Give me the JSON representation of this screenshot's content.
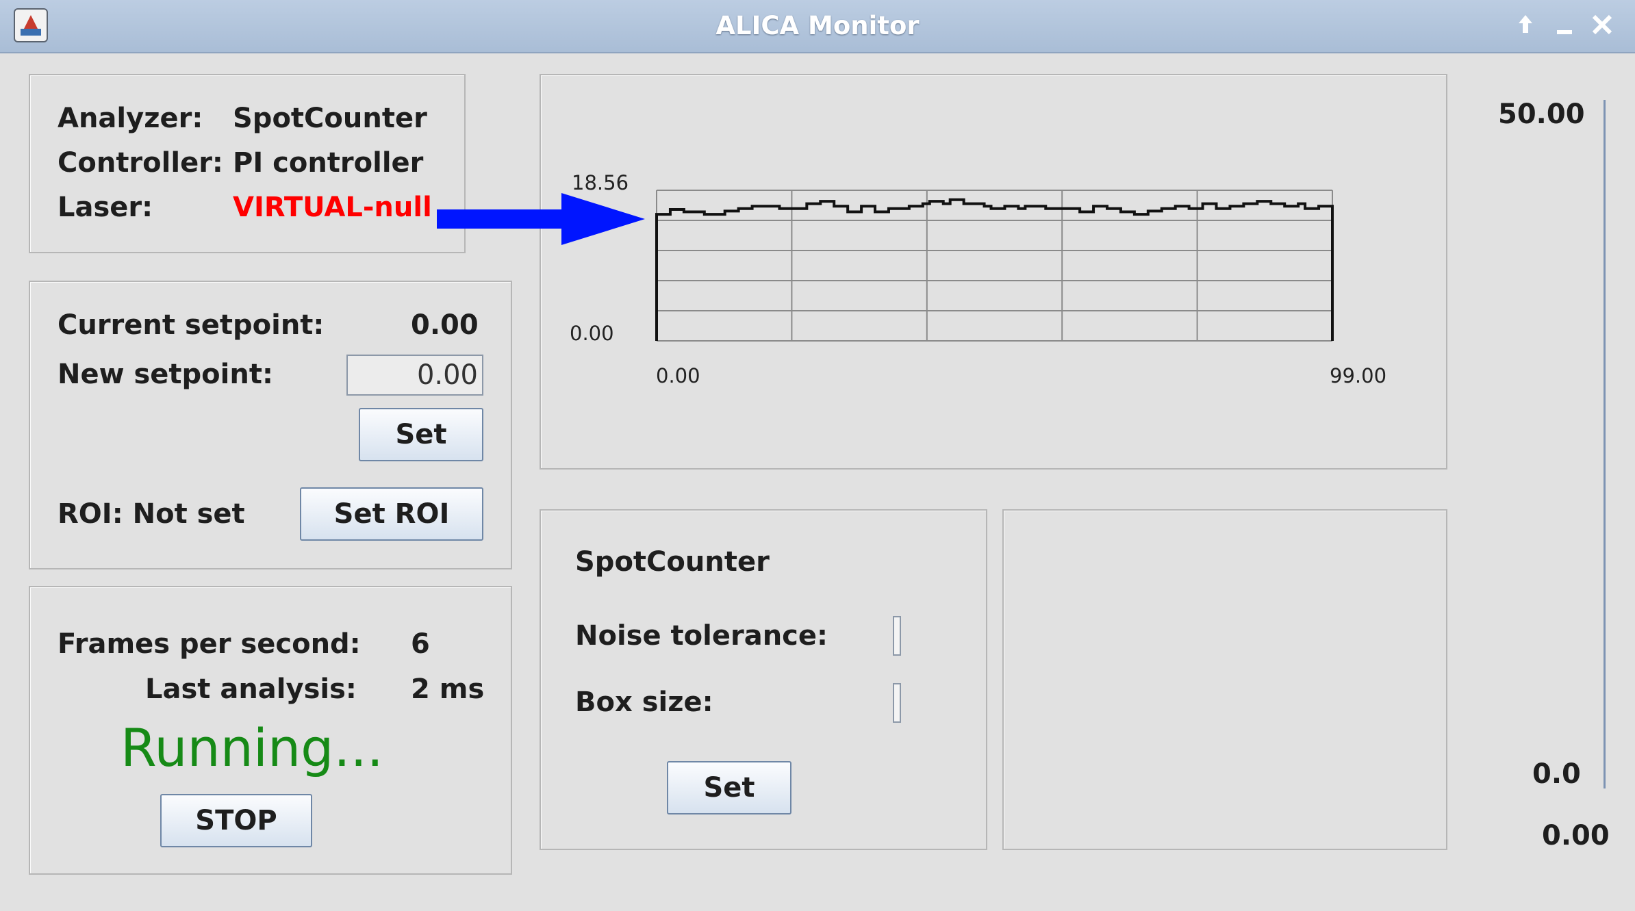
{
  "window": {
    "title": "ALICA Monitor"
  },
  "info": {
    "analyzer_label": "Analyzer:",
    "analyzer_value": "SpotCounter",
    "controller_label": "Controller:",
    "controller_value": "PI controller",
    "laser_label": "Laser:",
    "laser_value": "VIRTUAL-null"
  },
  "setpoint": {
    "current_label": "Current setpoint:",
    "current_value": "0.00",
    "new_label": "New setpoint:",
    "new_value": "0.00",
    "set_button": "Set",
    "roi_label": "ROI: Not set",
    "roi_button": "Set ROI"
  },
  "status": {
    "fps_label": "Frames per second:",
    "fps_value": "6",
    "last_label": "Last analysis:",
    "last_value": "2 ms",
    "running_text": "Running...",
    "stop_button": "STOP"
  },
  "analyzer_panel": {
    "title": "SpotCounter",
    "noise_label": "Noise tolerance:",
    "box_label": "Box size:",
    "set_button": "Set"
  },
  "right_scale": {
    "top": "50.00",
    "bottom": "0.0",
    "value": "0.00"
  },
  "colors": {
    "laser": "#ff0000",
    "running": "#168a16",
    "arrow": "#0015ff"
  },
  "chart_data": {
    "type": "line",
    "y_max_label": "18.56",
    "y_min_label": "0.00",
    "x_min_label": "0.00",
    "x_max_label": "99.00",
    "xlim": [
      0,
      99
    ],
    "ylim": [
      0,
      18.56
    ],
    "grid": true,
    "series": [
      {
        "values": [
          15.6,
          15.6,
          16.2,
          16.2,
          15.9,
          15.9,
          15.9,
          15.6,
          15.6,
          15.6,
          16.0,
          16.0,
          16.3,
          16.3,
          16.6,
          16.6,
          16.6,
          16.6,
          16.3,
          16.3,
          16.3,
          16.3,
          16.9,
          16.9,
          17.2,
          17.2,
          16.6,
          16.6,
          15.9,
          15.9,
          16.6,
          16.6,
          15.9,
          15.9,
          16.3,
          16.3,
          16.3,
          16.6,
          16.6,
          16.9,
          17.2,
          17.2,
          16.9,
          17.4,
          17.4,
          16.9,
          16.9,
          16.9,
          16.6,
          16.3,
          16.3,
          16.6,
          16.6,
          16.3,
          16.6,
          16.6,
          16.6,
          16.3,
          16.3,
          16.3,
          16.3,
          16.3,
          15.9,
          15.9,
          16.6,
          16.6,
          16.3,
          16.3,
          15.9,
          15.9,
          15.6,
          15.6,
          16.0,
          16.0,
          16.3,
          16.3,
          16.6,
          16.6,
          16.3,
          16.3,
          16.9,
          16.9,
          16.3,
          16.3,
          16.6,
          16.6,
          16.9,
          16.9,
          17.2,
          17.2,
          16.9,
          16.9,
          16.6,
          16.6,
          16.9,
          16.3,
          16.3,
          16.6,
          16.6,
          16.3
        ]
      }
    ]
  }
}
